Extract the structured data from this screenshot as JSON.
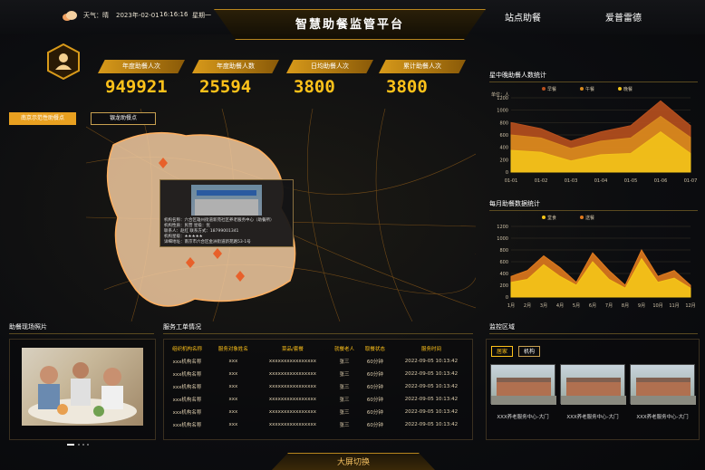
{
  "header": {
    "weather": "天气：晴",
    "date": "2023年-02-01",
    "time": "16:16:16",
    "weekday": "星期一",
    "title": "智慧助餐监管平台",
    "nav_station": "站点助餐",
    "nav_brand": "爱普雷德"
  },
  "stats": [
    {
      "label": "年度助餐人次",
      "value": "949921"
    },
    {
      "label": "年度助餐人数",
      "value": "25594"
    },
    {
      "label": "日均助餐人次",
      "value": "3800"
    },
    {
      "label": "累计助餐人次",
      "value": "3800"
    }
  ],
  "map": {
    "btn_active": "南京示范性助餐点",
    "btn_other": "银龙助餐点",
    "popup": {
      "lines": [
        "机构名称：六合区雄州街道新苑社区养老服务中心（助餐所）",
        "机构性质：民营   星级：优",
        "联系人：赵红   联系方式：18799001341",
        "机构星级：★★★★★",
        "详细地址：南京市六合区金洲街道新苑路53-1号"
      ]
    }
  },
  "chart1": {
    "title": "星中晚助餐人数统计",
    "ylabel": "单位：人",
    "legend": [
      "早餐",
      "午餐",
      "晚餐"
    ],
    "chart_data": {
      "type": "area",
      "x": [
        "01-01",
        "01-02",
        "01-03",
        "01-04",
        "01-05",
        "01-06",
        "01-07"
      ],
      "ylim": [
        0,
        1200
      ],
      "yticks": [
        0,
        200,
        400,
        600,
        800,
        1000,
        1200
      ],
      "series": [
        {
          "name": "早餐",
          "values": [
            800,
            700,
            500,
            650,
            750,
            1150,
            750
          ]
        },
        {
          "name": "午餐",
          "values": [
            600,
            550,
            380,
            500,
            550,
            900,
            560
          ]
        },
        {
          "name": "晚餐",
          "values": [
            350,
            320,
            180,
            280,
            300,
            650,
            300
          ]
        }
      ],
      "colors": [
        "#b8501e",
        "#d88a1e",
        "#f2c21a"
      ]
    }
  },
  "chart2": {
    "title": "每月助餐数据统计",
    "legend": [
      "堂食",
      "送餐"
    ],
    "chart_data": {
      "type": "area",
      "x": [
        "1月",
        "2月",
        "3月",
        "4月",
        "5月",
        "6月",
        "7月",
        "8月",
        "9月",
        "10月",
        "11月",
        "12月"
      ],
      "ylim": [
        0,
        1200
      ],
      "yticks": [
        0,
        200,
        400,
        600,
        800,
        1000,
        1200
      ],
      "series": [
        {
          "name": "送餐",
          "values": [
            350,
            450,
            700,
            500,
            250,
            750,
            450,
            200,
            800,
            350,
            450,
            200
          ]
        },
        {
          "name": "堂食",
          "values": [
            250,
            300,
            550,
            350,
            200,
            600,
            300,
            150,
            650,
            250,
            320,
            150
          ]
        }
      ],
      "colors": [
        "#e07a1e",
        "#f5c518"
      ]
    }
  },
  "photos": {
    "title": "助餐现场照片"
  },
  "orders": {
    "title": "服务工单情况",
    "columns": [
      "组织机构名称",
      "服务对象姓名",
      "菜品/套餐",
      "就餐老人",
      "取餐状态",
      "服务时间"
    ],
    "rows": [
      [
        "xxx机构名称",
        "xxx",
        "xxxxxxxxxxxxxxxx",
        "张三",
        "60分钟",
        "2022-09-05 10:13:42"
      ],
      [
        "xxx机构名称",
        "xxx",
        "xxxxxxxxxxxxxxxx",
        "张三",
        "60分钟",
        "2022-09-05 10:13:42"
      ],
      [
        "xxx机构名称",
        "xxx",
        "xxxxxxxxxxxxxxxx",
        "张三",
        "60分钟",
        "2022-09-05 10:13:42"
      ],
      [
        "xxx机构名称",
        "xxx",
        "xxxxxxxxxxxxxxxx",
        "张三",
        "60分钟",
        "2022-09-05 10:13:42"
      ],
      [
        "xxx机构名称",
        "xxx",
        "xxxxxxxxxxxxxxxx",
        "张三",
        "60分钟",
        "2022-09-05 10:13:42"
      ],
      [
        "xxx机构名称",
        "xxx",
        "xxxxxxxxxxxxxxxx",
        "张三",
        "60分钟",
        "2022-09-05 10:13:42"
      ]
    ]
  },
  "monitor": {
    "title": "监控区域",
    "tabs": [
      "居家",
      "机构"
    ],
    "cams": [
      "XXX养老服务中心-大门",
      "XXX养老服务中心-大门",
      "XXX养老服务中心-大门"
    ]
  },
  "footer": {
    "switch": "大屏切换"
  }
}
